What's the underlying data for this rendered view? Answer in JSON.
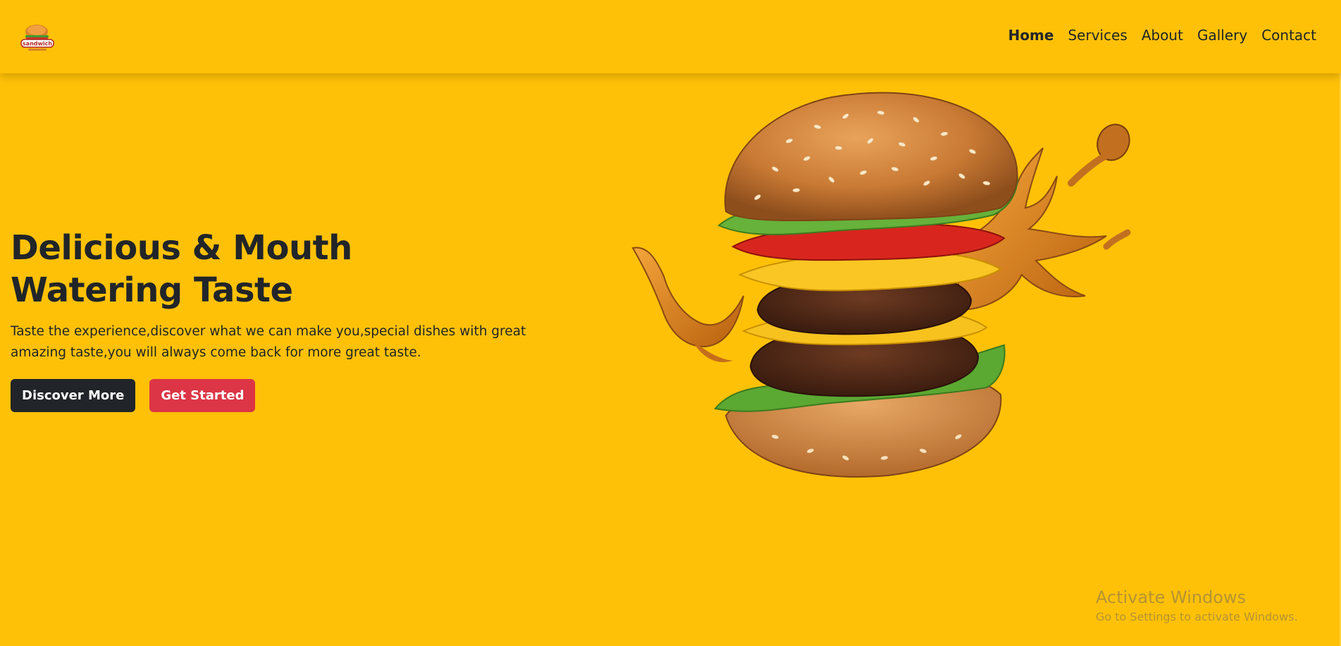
{
  "brand": {
    "logo_text": "sandwich",
    "logo_icon": "sandwich-logo-icon"
  },
  "nav": {
    "links": [
      {
        "label": "Home",
        "active": true
      },
      {
        "label": "Services",
        "active": false
      },
      {
        "label": "About",
        "active": false
      },
      {
        "label": "Gallery",
        "active": false
      },
      {
        "label": "Contact",
        "active": false
      }
    ]
  },
  "hero": {
    "title_line1": "Delicious & Mouth",
    "title_line2": "Watering Taste",
    "description": "Taste the experience,discover what we can make you,special dishes with great amazing taste,you will always come back for more great taste.",
    "primary_button": "Discover More",
    "secondary_button": "Get Started",
    "image": "burger-with-sauce-splash"
  },
  "watermark": {
    "title": "Activate Windows",
    "subtitle": "Go to Settings to activate Windows."
  },
  "colors": {
    "background": "#FFC107",
    "text": "#212529",
    "button_dark": "#212529",
    "button_red": "#DC3545"
  }
}
